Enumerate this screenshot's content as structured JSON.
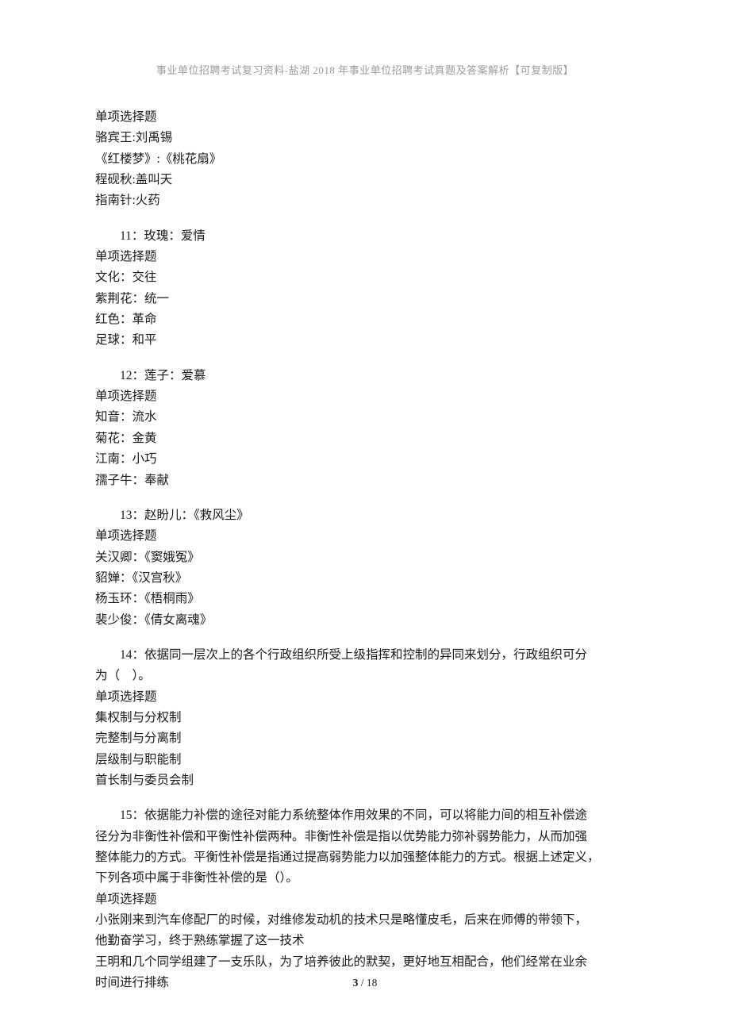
{
  "header": "事业单位招聘考试复习资料-盐湖 2018 年事业单位招聘考试真题及答案解析【可复制版】",
  "blocks": [
    {
      "lines": [
        {
          "text": "单项选择题",
          "indent": false
        },
        {
          "text": "骆宾王:刘禹锡",
          "indent": false
        },
        {
          "text": "《红楼梦》:《桃花扇》",
          "indent": false
        },
        {
          "text": "程砚秋:盖叫天",
          "indent": false
        },
        {
          "text": "指南针:火药",
          "indent": false
        }
      ]
    },
    {
      "lines": [
        {
          "text": "11：玫瑰：爱情",
          "indent": true
        },
        {
          "text": "单项选择题",
          "indent": false
        },
        {
          "text": "文化：交往",
          "indent": false
        },
        {
          "text": "紫荆花：统一",
          "indent": false
        },
        {
          "text": "红色：革命",
          "indent": false
        },
        {
          "text": "足球：和平",
          "indent": false
        }
      ]
    },
    {
      "lines": [
        {
          "text": "12：莲子：爱慕",
          "indent": true
        },
        {
          "text": "单项选择题",
          "indent": false
        },
        {
          "text": "知音：流水",
          "indent": false
        },
        {
          "text": "菊花：金黄",
          "indent": false
        },
        {
          "text": "江南：小巧",
          "indent": false
        },
        {
          "text": "孺子牛：奉献",
          "indent": false
        }
      ]
    },
    {
      "lines": [
        {
          "text": "13：赵盼儿：《救风尘》",
          "indent": true
        },
        {
          "text": "单项选择题",
          "indent": false
        },
        {
          "text": "关汉卿：《窦娥冤》",
          "indent": false
        },
        {
          "text": "貂婵：《汉宫秋》",
          "indent": false
        },
        {
          "text": "杨玉环：《梧桐雨》",
          "indent": false
        },
        {
          "text": "裴少俊：《倩女离魂》",
          "indent": false
        }
      ]
    },
    {
      "lines": [
        {
          "text": "14：依据同一层次上的各个行政组织所受上级指挥和控制的异同来划分，行政组织可分",
          "indent": true
        },
        {
          "text": "为（　）。",
          "indent": false
        },
        {
          "text": "单项选择题",
          "indent": false
        },
        {
          "text": "集权制与分权制",
          "indent": false
        },
        {
          "text": "完整制与分离制",
          "indent": false
        },
        {
          "text": "层级制与职能制",
          "indent": false
        },
        {
          "text": "首长制与委员会制",
          "indent": false
        }
      ]
    },
    {
      "lines": [
        {
          "text": "15：依据能力补偿的途径对能力系统整体作用效果的不同，可以将能力间的相互补偿途",
          "indent": true
        },
        {
          "text": "径分为非衡性补偿和平衡性补偿两种。非衡性补偿是指以优势能力弥补弱势能力，从而加强",
          "indent": false
        },
        {
          "text": "整体能力的方式。平衡性补偿是指通过提高弱势能力以加强整体能力的方式。根据上述定义，",
          "indent": false
        },
        {
          "text": "下列各项中属于非衡性补偿的是（）。",
          "indent": false
        },
        {
          "text": "单项选择题",
          "indent": false
        },
        {
          "text": "小张刚来到汽车修配厂的时候，对维修发动机的技术只是略懂皮毛，后来在师傅的带领下，",
          "indent": false
        },
        {
          "text": "他勤奋学习，终于熟练掌握了这一技术",
          "indent": false
        },
        {
          "text": "王明和几个同学组建了一支乐队，为了培养彼此的默契，更好地互相配合，他们经常在业余",
          "indent": false
        },
        {
          "text": "时间进行排练",
          "indent": false
        }
      ]
    }
  ],
  "footer": {
    "current": "3",
    "sep": " / ",
    "total": "18"
  }
}
